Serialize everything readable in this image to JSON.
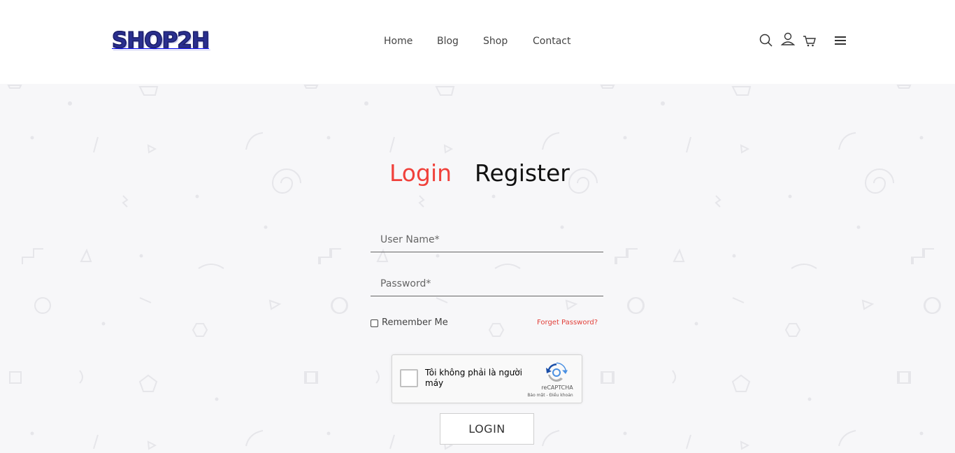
{
  "logo": {
    "text": "SHOP2H"
  },
  "nav": {
    "items": [
      "Home",
      "Blog",
      "Shop",
      "Contact"
    ]
  },
  "header_icons": [
    "search-icon",
    "user-icon",
    "cart-icon",
    "menu-icon"
  ],
  "tabs": {
    "login": "Login",
    "register": "Register"
  },
  "form": {
    "username_placeholder": "User Name*",
    "username_value": "",
    "password_placeholder": "Password*",
    "password_value": "",
    "remember_label": "Remember Me",
    "remember_checked": false,
    "forget_link": "Forget Password?",
    "login_button": "LOGIN"
  },
  "captcha": {
    "label": "Tôi không phải là người máy",
    "brand": "reCAPTCHA",
    "terms": "Bảo mật - Điều khoản"
  },
  "colors": {
    "accent": "#f0413b",
    "background": "#f7f7f9",
    "logo": "#2a2f8f"
  }
}
